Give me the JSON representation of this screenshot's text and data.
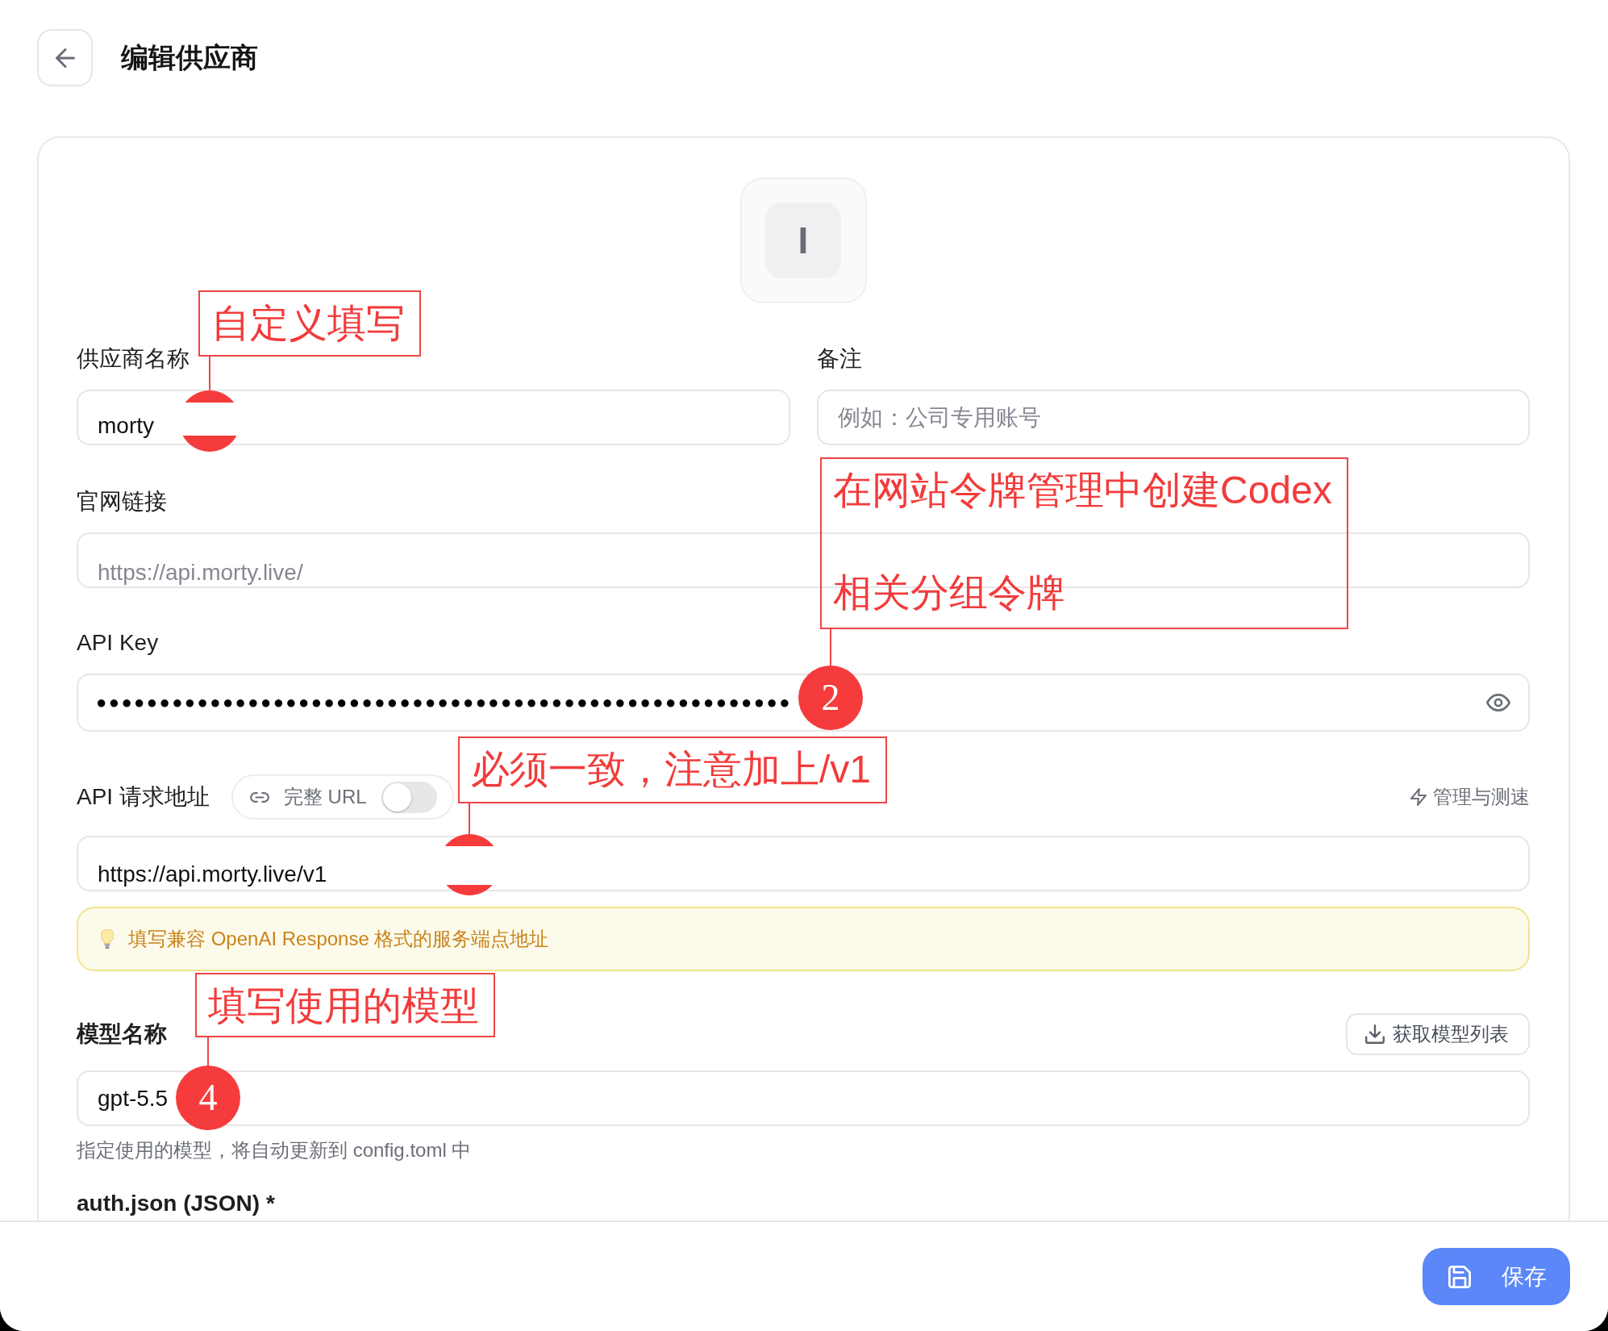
{
  "header": {
    "title": "编辑供应商"
  },
  "avatar": {
    "letter": "I"
  },
  "name_field": {
    "label": "供应商名称",
    "value": "morty"
  },
  "note_field": {
    "label": "备注",
    "placeholder": "例如：公司专用账号"
  },
  "website_field": {
    "label": "官网链接",
    "placeholder": "https://api.morty.live/"
  },
  "api_key_field": {
    "label": "API Key",
    "value": "●●●●●●●●●●●●●●●●●●●●●●●●●●●●●●●●●●●●●●●●●●●●●●●●●●●●●●●"
  },
  "endpoint": {
    "label": "API 请求地址",
    "full_url_toggle": {
      "label": "完整 URL",
      "on": false
    },
    "manage_link": "管理与测速",
    "value": "https://api.morty.live/v1",
    "hint": "填写兼容 OpenAI Response 格式的服务端点地址"
  },
  "model": {
    "label": "模型名称",
    "fetch_button": "获取模型列表",
    "value": "gpt-5.5",
    "help": "指定使用的模型，将自动更新到 config.toml 中"
  },
  "auth_json": {
    "label": "auth.json (JSON) *"
  },
  "footer": {
    "save_button": "保存"
  },
  "annotations": [
    {
      "text_lines": [
        "自定义填写"
      ],
      "marker": {
        "kind": "covered"
      }
    },
    {
      "text_lines": [
        "在网站令牌管理中创建Codex",
        "相关分组令牌"
      ],
      "marker": {
        "kind": "badge",
        "number": "2"
      }
    },
    {
      "text_lines": [
        "必须一致，注意加上/v1"
      ],
      "marker": {
        "kind": "covered"
      }
    },
    {
      "text_lines": [
        "填写使用的模型"
      ],
      "marker": {
        "kind": "badge",
        "number": "4"
      }
    }
  ]
}
